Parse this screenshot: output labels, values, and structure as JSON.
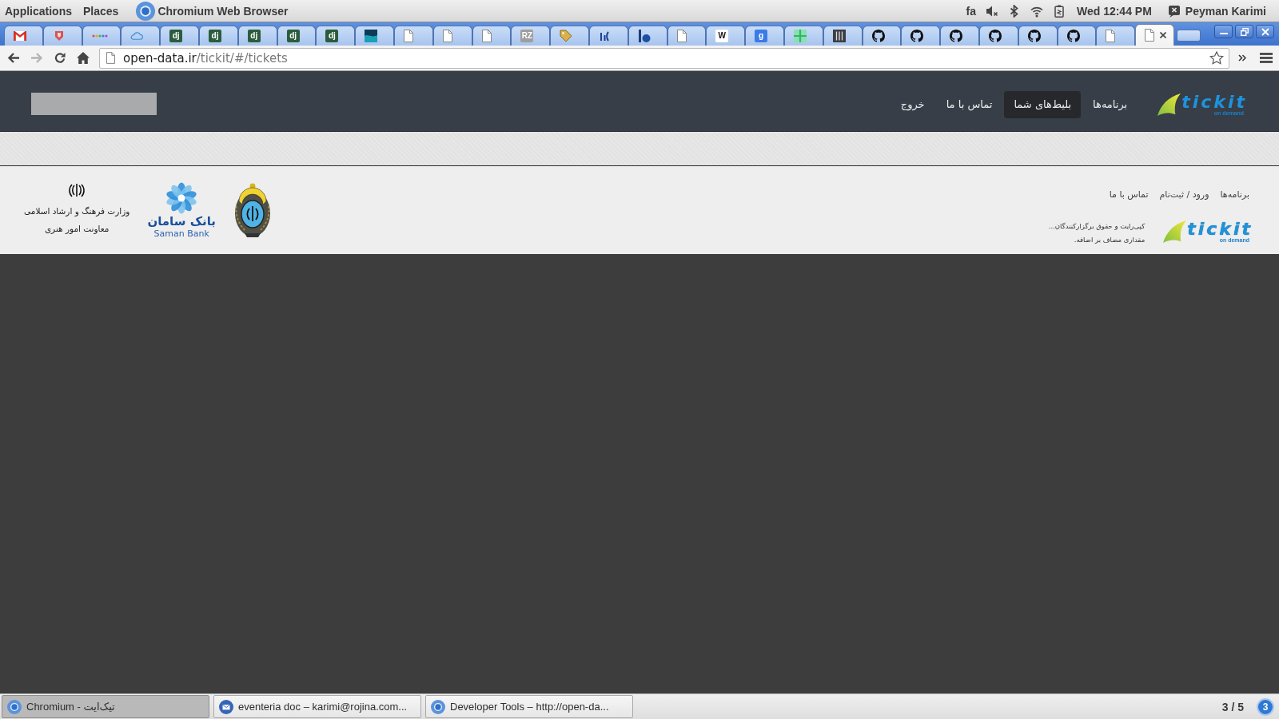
{
  "top_panel": {
    "menus": [
      "Places",
      "Applications"
    ],
    "active_app": "Chromium Web Browser",
    "keyboard_layout": "fa",
    "clock": "Wed 12:44 PM",
    "user": "Peyman Karimi"
  },
  "tabs": [
    {
      "kind": "page",
      "selected": true
    },
    {
      "kind": "page",
      "selected": false
    },
    {
      "kind": "cat",
      "selected": false
    },
    {
      "kind": "cat",
      "selected": false
    },
    {
      "kind": "cat",
      "selected": false
    },
    {
      "kind": "cat",
      "selected": false
    },
    {
      "kind": "cat",
      "selected": false
    },
    {
      "kind": "cat",
      "selected": false
    },
    {
      "kind": "columns",
      "selected": false
    },
    {
      "kind": "grid",
      "selected": false
    },
    {
      "kind": "letters",
      "text": "g",
      "color": "#3b7be8",
      "selected": false
    },
    {
      "kind": "letters",
      "text": "W",
      "color": "#ffffff",
      "selected": false
    },
    {
      "kind": "page",
      "selected": false
    },
    {
      "kind": "bardot",
      "selected": false
    },
    {
      "kind": "strokes",
      "selected": false
    },
    {
      "kind": "tag",
      "selected": false
    },
    {
      "kind": "letters",
      "text": "RZ",
      "color": "#9e9e9e",
      "selected": false
    },
    {
      "kind": "page",
      "selected": false
    },
    {
      "kind": "page",
      "selected": false
    },
    {
      "kind": "page",
      "selected": false
    },
    {
      "kind": "wave",
      "selected": false
    },
    {
      "kind": "letters",
      "text": "dj",
      "color": "#2b5c3c",
      "selected": false
    },
    {
      "kind": "letters",
      "text": "dj",
      "color": "#2b5c3c",
      "selected": false
    },
    {
      "kind": "letters",
      "text": "dj",
      "color": "#2b5c3c",
      "selected": false
    },
    {
      "kind": "letters",
      "text": "dj",
      "color": "#2b5c3c",
      "selected": false
    },
    {
      "kind": "letters",
      "text": "dj",
      "color": "#2b5c3c",
      "selected": false
    },
    {
      "kind": "cloud",
      "selected": false
    },
    {
      "kind": "dots",
      "selected": false
    },
    {
      "kind": "shield",
      "selected": false
    },
    {
      "kind": "mail",
      "selected": false
    }
  ],
  "toolbar": {
    "forward_disabled": true,
    "url_host": "open-data.ir",
    "url_path": "/tickit/#/tickets"
  },
  "header": {
    "logo": {
      "wordmark": "tickit",
      "tagline": "on demand"
    },
    "nav": [
      {
        "label": "برنامه‌ها",
        "selected": false
      },
      {
        "label": "بلیط‌های شما",
        "selected": true
      },
      {
        "label": "تماس با ما",
        "selected": false
      },
      {
        "label": "خروج",
        "selected": false
      }
    ]
  },
  "footer": {
    "links": [
      "برنامه‌ها",
      "ورود / ثبت‌نام",
      "تماس با ما"
    ],
    "logo": {
      "wordmark": "tickit",
      "tagline": "on demand"
    },
    "copyright": [
      "کپی‌رایت و حقوق برگزارکنندگان...",
      "مقداری مضاف بر اضافه."
    ],
    "sponsors": [
      {
        "kind": "crest"
      },
      {
        "kind": "bank",
        "lines": [
          "بانک سامان",
          "Saman Bank"
        ]
      },
      {
        "kind": "ministry",
        "lines": [
          "وزارت فرهنگ و ارشاد اسلامی",
          "معاونت امور هنری"
        ]
      }
    ]
  },
  "taskbar": {
    "windows": [
      {
        "kind": "browser",
        "title": "Developer Tools – http://open-da...",
        "selected": false
      },
      {
        "kind": "mail",
        "title": "eventeria doc – karimi@rojina.com...",
        "selected": false
      },
      {
        "kind": "browser",
        "title": "Chromium - تیک‌ایت",
        "selected": true
      }
    ],
    "workspace": "3 / 5",
    "notifications": "3"
  }
}
